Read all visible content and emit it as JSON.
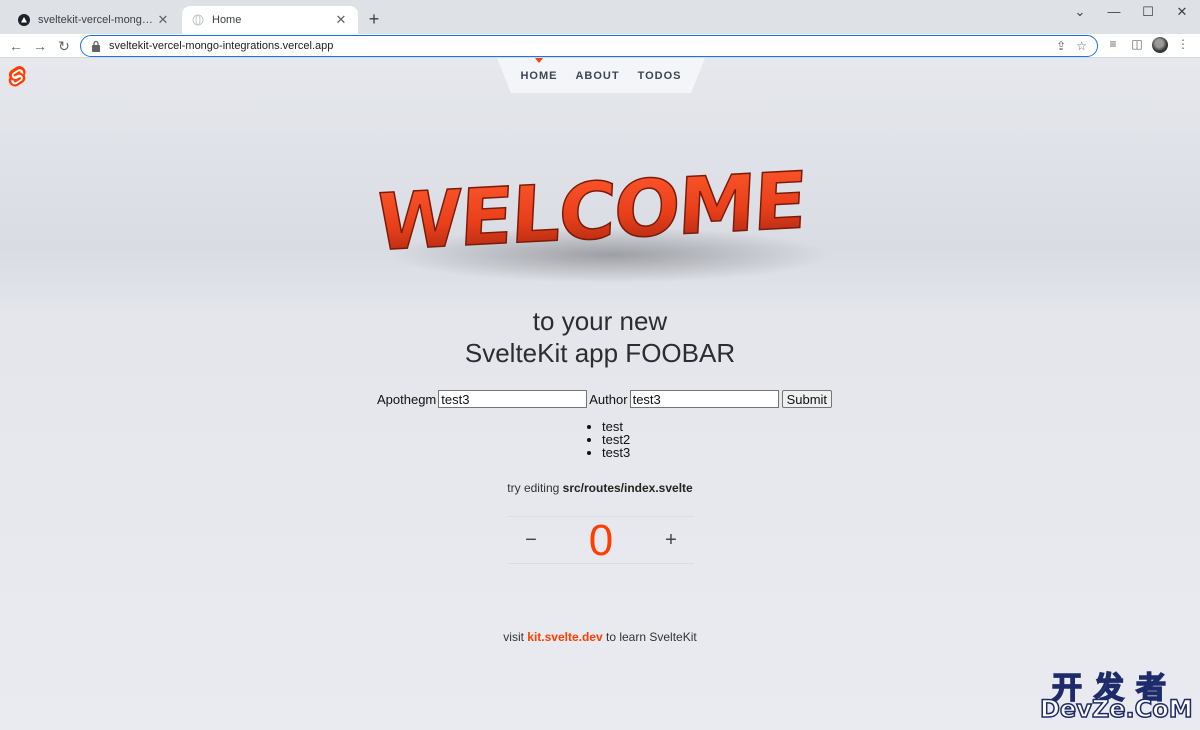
{
  "browser": {
    "tabs": [
      {
        "title": "sveltekit-vercel-mongo-integratio",
        "close": "✕",
        "active": false
      },
      {
        "title": "Home",
        "close": "✕",
        "active": true
      }
    ],
    "new_tab": "+",
    "window_controls": {
      "tab_search": "⌄",
      "minimize": "—",
      "maximize": "☐",
      "close": "✕"
    },
    "url": "sveltekit-vercel-mongo-integrations.vercel.app",
    "nav": {
      "back": "←",
      "forward": "→",
      "reload": "↻"
    },
    "toolbar_icons": {
      "share": "⇪",
      "bookmark": "☆",
      "reading_list": "≡",
      "side_panel": "◫",
      "menu": "⋮"
    }
  },
  "nav": {
    "items": [
      {
        "label": "HOME",
        "active": true
      },
      {
        "label": "ABOUT",
        "active": false
      },
      {
        "label": "TODOS",
        "active": false
      }
    ]
  },
  "hero": {
    "welcome_word": "WELCOME",
    "line1": "to your new",
    "line2": "SvelteKit app FOOBAR"
  },
  "form": {
    "apothegm_label": "Apothegm",
    "apothegm_value": "test3",
    "author_label": "Author",
    "author_value": "test3",
    "submit_label": "Submit"
  },
  "items": [
    "test",
    "test2",
    "test3"
  ],
  "edit_hint": {
    "prefix": "try editing ",
    "path": "src/routes/index.svelte"
  },
  "counter": {
    "decrement": "−",
    "value": "0",
    "increment": "+"
  },
  "footer": {
    "prefix": "visit ",
    "link": "kit.svelte.dev",
    "suffix": " to learn SvelteKit"
  },
  "watermark": {
    "line1": "开发者",
    "line2": "DevZe.CoM"
  },
  "colors": {
    "accent": "#ff3e00",
    "omnibox_focus": "#1a73e8",
    "text": "#2d2d2d"
  }
}
